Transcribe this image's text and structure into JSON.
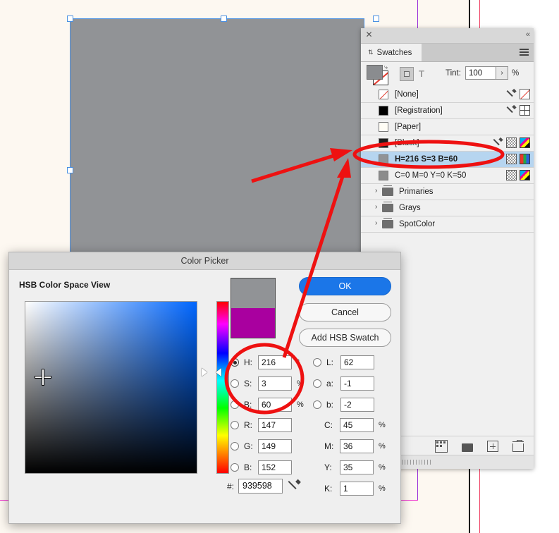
{
  "app": {
    "document_background": "#fdf8f1",
    "artwork_fill": "#919396",
    "selection_color": "#4a90e2",
    "annotation_color": "#ee1111"
  },
  "swatches_panel": {
    "close_icon": "close-icon",
    "collapse_icon": "«",
    "tab_label": "Swatches",
    "tab_handle_icon": "⇅",
    "menu_icon": "panel-menu-icon",
    "toolbar": {
      "fill_label": "Fill",
      "stroke_label": "Stroke",
      "swap_icon": "⤷",
      "text_format_icon": "T",
      "tint_label": "Tint:",
      "tint_value": "100",
      "tint_stepper": "›",
      "tint_unit": "%"
    },
    "rows": [
      {
        "name": "[None]",
        "chip": "none",
        "bold": false,
        "selected": false,
        "icons": [
          "dropper",
          "none"
        ]
      },
      {
        "name": "[Registration]",
        "chip": "#000000",
        "bold": false,
        "selected": false,
        "icons": [
          "dropper",
          "registration"
        ]
      },
      {
        "name": "[Paper]",
        "chip": "#fffdf5",
        "bold": false,
        "selected": false,
        "icons": []
      },
      {
        "name": "[Black]",
        "chip": "#1c1c1c",
        "bold": false,
        "selected": false,
        "icons": [
          "dropper",
          "checker",
          "cmyk"
        ]
      },
      {
        "name": "H=216 S=3 B=60",
        "chip": "#919396",
        "bold": true,
        "selected": true,
        "icons": [
          "checker",
          "rgb"
        ]
      },
      {
        "name": "C=0 M=0 Y=0 K=50",
        "chip": "#8c8c8c",
        "bold": false,
        "selected": false,
        "icons": [
          "checker",
          "cmyk"
        ]
      }
    ],
    "groups": [
      {
        "name": "Primaries",
        "arrow": "›"
      },
      {
        "name": "Grays",
        "arrow": "›"
      },
      {
        "name": "SpotColor",
        "arrow": "›"
      }
    ],
    "bottom_icons": [
      "show-swatch-kinds-icon",
      "new-color-group-icon",
      "new-swatch-icon",
      "delete-swatch-icon"
    ]
  },
  "color_picker": {
    "title": "Color Picker",
    "subtitle": "HSB Color Space View",
    "buttons": {
      "ok": "OK",
      "cancel": "Cancel",
      "add_swatch": "Add HSB Swatch"
    },
    "preview": {
      "new_color": "#919396",
      "previous_color": "#a9009f"
    },
    "hsb": [
      {
        "key": "H",
        "label": "H:",
        "value": "216",
        "unit": "°",
        "selected": true
      },
      {
        "key": "S",
        "label": "S:",
        "value": "3",
        "unit": "%",
        "selected": false
      },
      {
        "key": "B",
        "label": "B:",
        "value": "60",
        "unit": "%",
        "selected": false
      }
    ],
    "lab": [
      {
        "key": "L",
        "label": "L:",
        "value": "62",
        "unit": "",
        "selected": false
      },
      {
        "key": "a",
        "label": "a:",
        "value": "-1",
        "unit": "",
        "selected": false
      },
      {
        "key": "b",
        "label": "b:",
        "value": "-2",
        "unit": "",
        "selected": false
      }
    ],
    "rgb": [
      {
        "key": "R",
        "label": "R:",
        "value": "147",
        "unit": "",
        "selected": false
      },
      {
        "key": "G",
        "label": "G:",
        "value": "149",
        "unit": "",
        "selected": false
      },
      {
        "key": "B",
        "label": "B:",
        "value": "152",
        "unit": "",
        "selected": false
      }
    ],
    "cmyk": [
      {
        "key": "C",
        "label": "C:",
        "value": "45",
        "unit": "%"
      },
      {
        "key": "M",
        "label": "M:",
        "value": "36",
        "unit": "%"
      },
      {
        "key": "Y",
        "label": "Y:",
        "value": "35",
        "unit": "%"
      },
      {
        "key": "K",
        "label": "K:",
        "value": "1",
        "unit": "%"
      }
    ],
    "hex": {
      "label": "#:",
      "value": "939598",
      "eyedropper_icon": "eyedropper-icon"
    }
  }
}
